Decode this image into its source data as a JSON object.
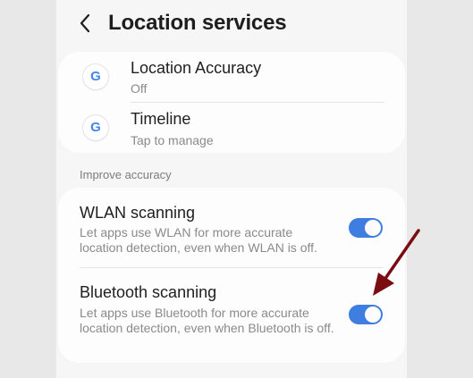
{
  "header": {
    "title": "Location services"
  },
  "top_card": {
    "items": [
      {
        "icon": "google-g-icon",
        "glyph": "G",
        "title": "Location Accuracy",
        "subtitle": "Off"
      },
      {
        "icon": "google-g-icon",
        "glyph": "G",
        "title": "Timeline",
        "subtitle": "Tap to manage"
      }
    ]
  },
  "improve_section": {
    "header": "Improve accuracy",
    "items": [
      {
        "title": "WLAN scanning",
        "description": "Let apps use WLAN for more accurate location detection, even when WLAN is off.",
        "enabled": true
      },
      {
        "title": "Bluetooth scanning",
        "description": "Let apps use Bluetooth for more accurate location detection, even when Bluetooth is off.",
        "enabled": true
      }
    ]
  },
  "colors": {
    "toggle_on": "#3d7ee0",
    "google_blue": "#4285F4",
    "annotation_arrow": "#7a0d12"
  }
}
